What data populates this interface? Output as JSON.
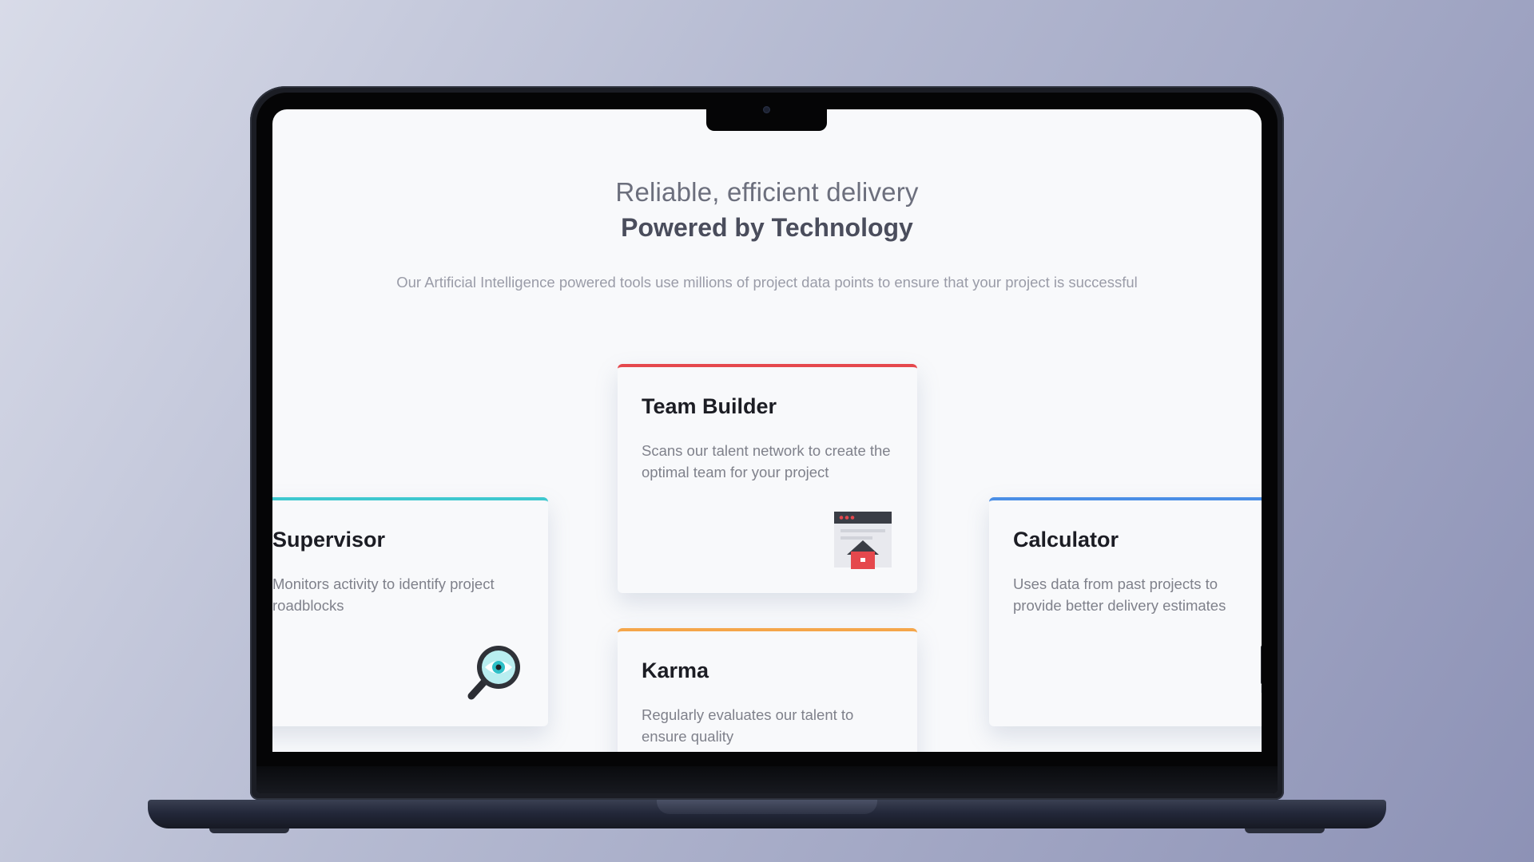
{
  "hero": {
    "subtitle": "Reliable, efficient delivery",
    "title": "Powered by Technology",
    "description": "Our Artificial Intelligence powered tools use millions of project data points to ensure that your project is successful"
  },
  "cards": [
    {
      "title": "Team Builder",
      "description": "Scans our talent network to create the optimal team for your project",
      "accent": "#e5484d",
      "icon": "team-builder-house-icon"
    },
    {
      "title": "Supervisor",
      "description": "Monitors activity to identify project roadblocks",
      "accent": "#3ec8cf",
      "icon": "magnifier-eye-icon"
    },
    {
      "title": "Calculator",
      "description": "Uses data from past projects to provide better delivery estimates",
      "accent": "#4a8ee6",
      "icon": "monitor-chart-icon"
    },
    {
      "title": "Karma",
      "description": "Regularly evaluates our talent to ensure quality",
      "accent": "#f5a64a",
      "icon": ""
    }
  ]
}
